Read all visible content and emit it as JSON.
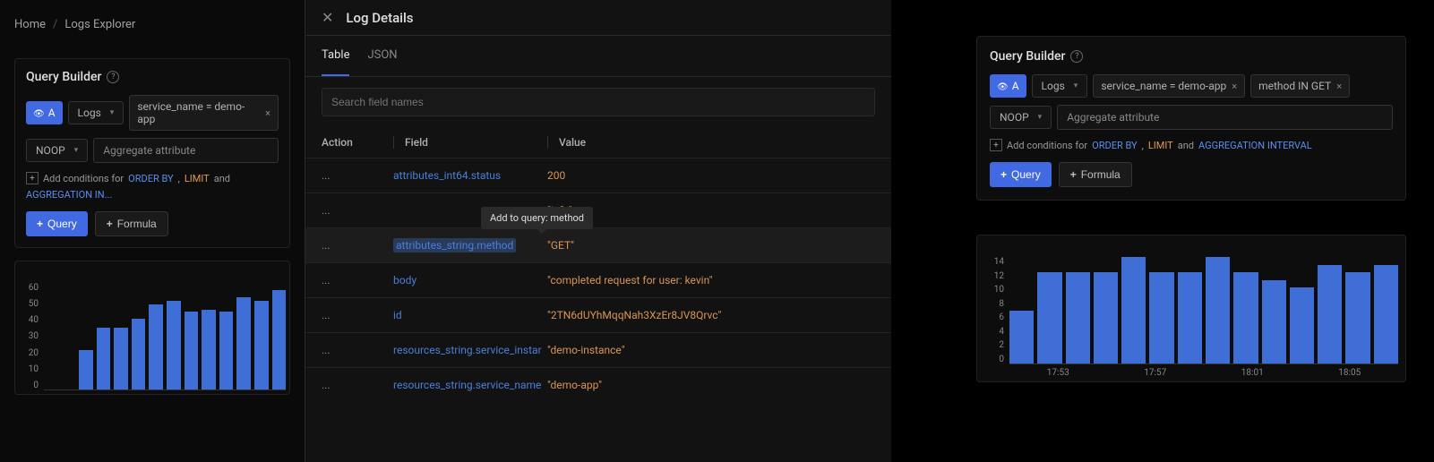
{
  "breadcrumb": {
    "home": "Home",
    "current": "Logs Explorer"
  },
  "query_builder": {
    "title": "Query Builder",
    "badge": "A",
    "source": "Logs",
    "filter1": "service_name = demo-app",
    "filter2": "method IN GET",
    "aggregator": "NOOP",
    "aggregate_placeholder": "Aggregate attribute",
    "conditions_prefix": "Add conditions for",
    "order_by": "ORDER BY",
    "limit": "LIMIT",
    "and": "and",
    "aggregation": "AGGREGATION INTERVAL",
    "query_btn": "Query",
    "formula_btn": "Formula"
  },
  "modal": {
    "title": "Log Details",
    "tabs": {
      "table": "Table",
      "json": "JSON"
    },
    "search_placeholder": "Search field names",
    "headers": {
      "action": "Action",
      "field": "Field",
      "value": "Value"
    },
    "tooltip": "Add to query: method",
    "rows": [
      {
        "field": "attributes_int64.status",
        "value": "200"
      },
      {
        "field": "",
        "value": "\"info\""
      },
      {
        "field": "attributes_string.method",
        "value": "\"GET\"",
        "selected": true
      },
      {
        "field": "body",
        "value": "\"completed request for user: kevin\""
      },
      {
        "field": "id",
        "value": "\"2TN6dUYhMqqNah3XzEr8JV8Qrvc\""
      },
      {
        "field": "resources_string.service_instar",
        "value": "\"demo-instance\""
      },
      {
        "field": "resources_string.service_name",
        "value": "\"demo-app\""
      }
    ]
  },
  "chart_data": [
    {
      "type": "bar",
      "ylim": [
        0,
        60
      ],
      "y_ticks": [
        "60",
        "50",
        "40",
        "30",
        "20",
        "10",
        "0"
      ],
      "values": [
        0,
        0,
        22,
        35,
        35,
        40,
        48,
        50,
        44,
        45,
        44,
        52,
        50,
        56
      ]
    },
    {
      "type": "bar",
      "ylim": [
        0,
        14
      ],
      "y_ticks": [
        "14",
        "12",
        "10",
        "8",
        "6",
        "4",
        "2",
        "0"
      ],
      "x_ticks": [
        "17:53",
        "17:57",
        "18:01",
        "18:05"
      ],
      "values": [
        7,
        12,
        12,
        12,
        14,
        12,
        12,
        14,
        12,
        11,
        10,
        13,
        12,
        13
      ]
    }
  ]
}
